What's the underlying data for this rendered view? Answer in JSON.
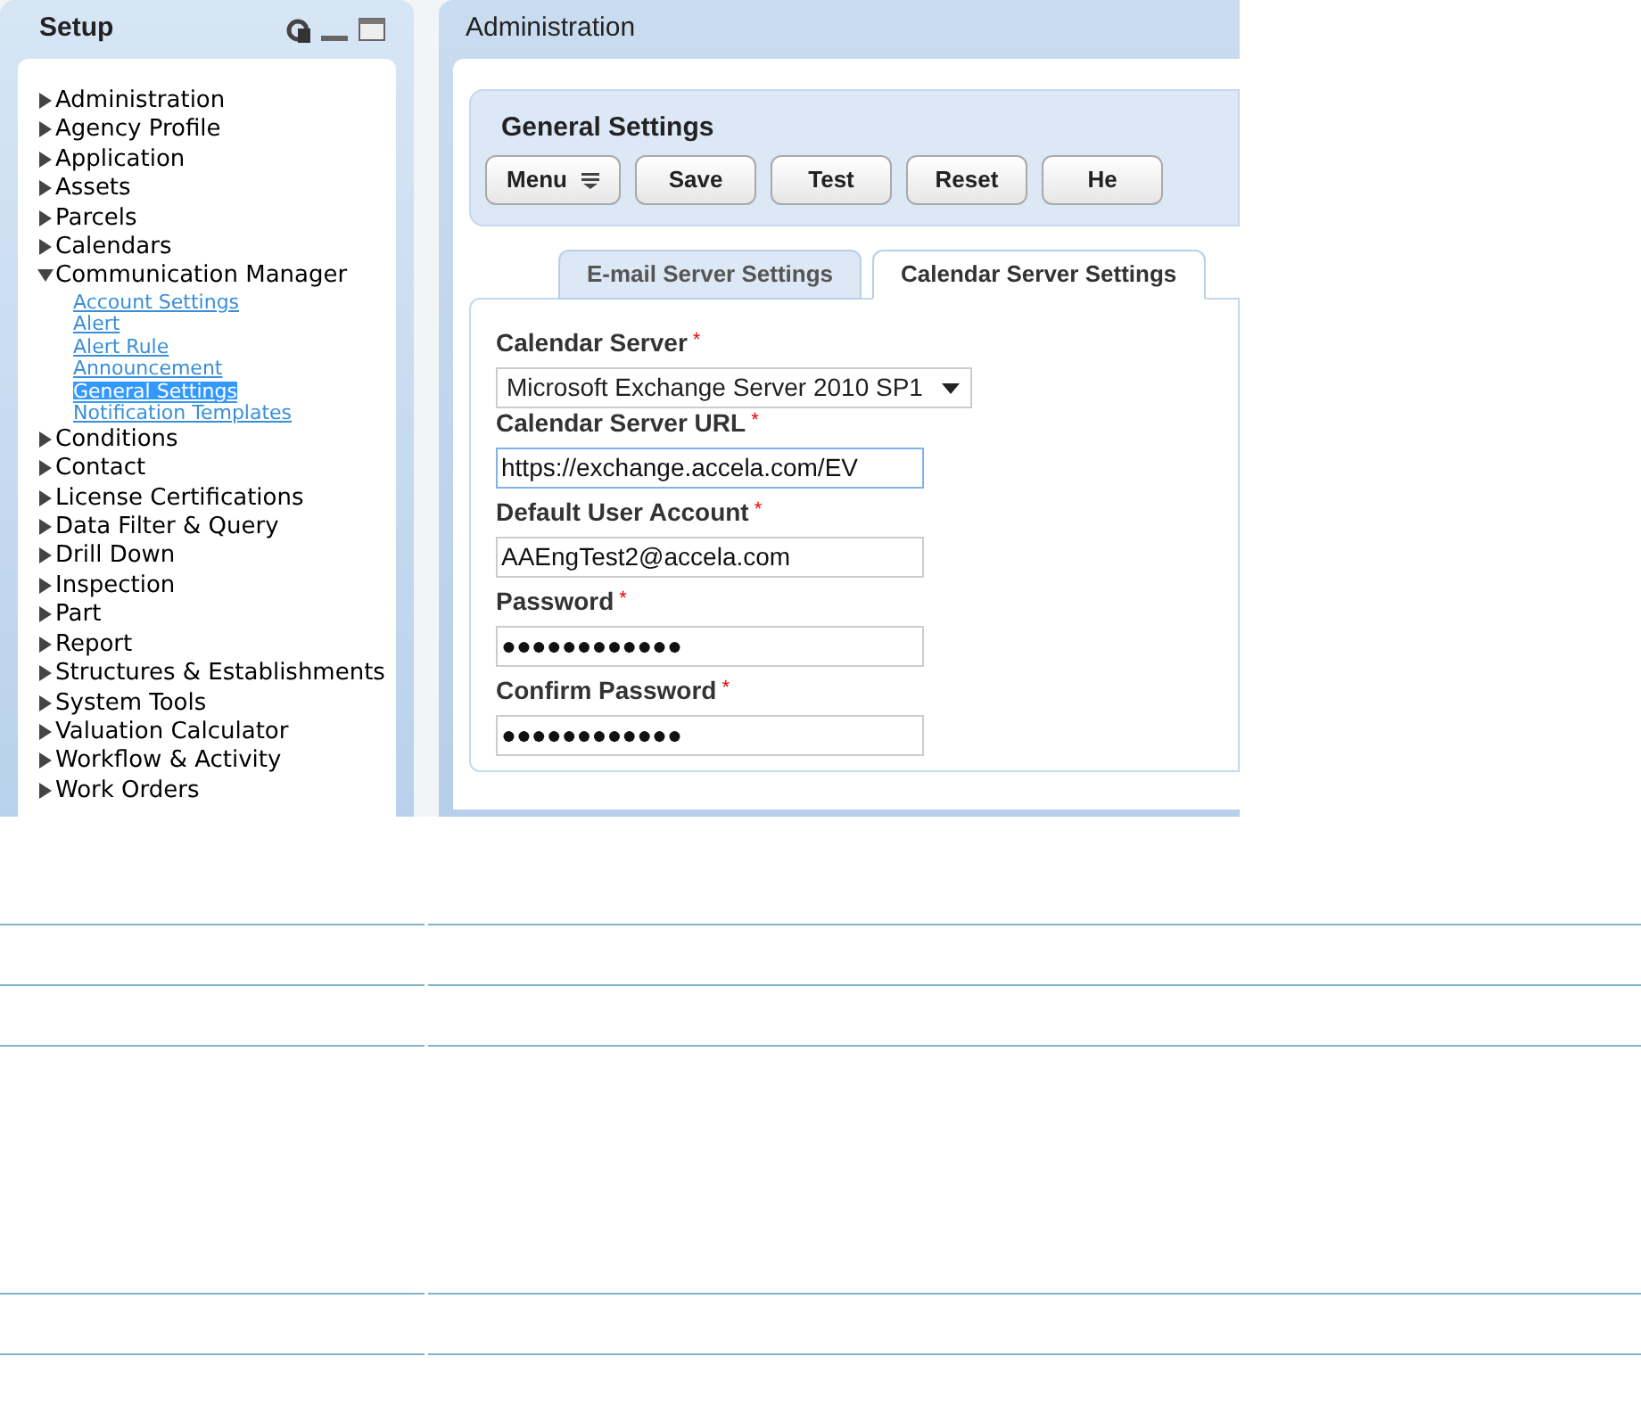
{
  "sidebar": {
    "title": "Setup",
    "items": [
      {
        "label": "Administration",
        "expanded": false
      },
      {
        "label": "Agency Profile",
        "expanded": false
      },
      {
        "label": "Application",
        "expanded": false
      },
      {
        "label": "Assets",
        "expanded": false
      },
      {
        "label": "Parcels",
        "expanded": false
      },
      {
        "label": "Calendars",
        "expanded": false
      },
      {
        "label": "Communication Manager",
        "expanded": true,
        "children": [
          {
            "label": "Account Settings",
            "selected": false
          },
          {
            "label": "Alert",
            "selected": false
          },
          {
            "label": "Alert Rule",
            "selected": false
          },
          {
            "label": "Announcement",
            "selected": false
          },
          {
            "label": "General Settings",
            "selected": true
          },
          {
            "label": "Notification Templates",
            "selected": false
          }
        ]
      },
      {
        "label": "Conditions",
        "expanded": false
      },
      {
        "label": "Contact",
        "expanded": false
      },
      {
        "label": "License Certifications",
        "expanded": false
      },
      {
        "label": "Data Filter & Query",
        "expanded": false
      },
      {
        "label": "Drill Down",
        "expanded": false
      },
      {
        "label": "Inspection",
        "expanded": false
      },
      {
        "label": "Part",
        "expanded": false
      },
      {
        "label": "Report",
        "expanded": false
      },
      {
        "label": "Structures & Establishments",
        "expanded": false
      },
      {
        "label": "System Tools",
        "expanded": false
      },
      {
        "label": "Valuation Calculator",
        "expanded": false
      },
      {
        "label": "Workflow & Activity",
        "expanded": false
      },
      {
        "label": "Work Orders",
        "expanded": false
      }
    ]
  },
  "main": {
    "title": "Administration",
    "section_title": "General Settings",
    "buttons": [
      {
        "label": "Menu",
        "kind": "menu"
      },
      {
        "label": "Save",
        "kind": "plain"
      },
      {
        "label": "Test",
        "kind": "plain"
      },
      {
        "label": "Reset",
        "kind": "plain"
      },
      {
        "label": "He",
        "kind": "plain"
      }
    ],
    "tabs": [
      {
        "label": "E-mail Server Settings",
        "selected": false
      },
      {
        "label": "Calendar Server Settings",
        "selected": true
      }
    ],
    "fields": [
      {
        "label": "Calendar Server",
        "required_mark": "*",
        "kind": "select",
        "value": "Microsoft Exchange Server 2010 SP1"
      },
      {
        "label": "Calendar Server URL",
        "required_mark": "*",
        "kind": "text",
        "value": "https://exchange.accela.com/EV",
        "focused": true
      },
      {
        "label": "Default User Account",
        "required_mark": "*",
        "kind": "text",
        "value": "AAEngTest2@accela.com",
        "focused": false
      },
      {
        "label": "Password",
        "required_mark": "*",
        "kind": "text",
        "value": "●●●●●●●●●●●●",
        "focused": false
      },
      {
        "label": "Confirm Password",
        "required_mark": "*",
        "kind": "text",
        "value": "●●●●●●●●●●●●",
        "focused": false
      }
    ]
  }
}
